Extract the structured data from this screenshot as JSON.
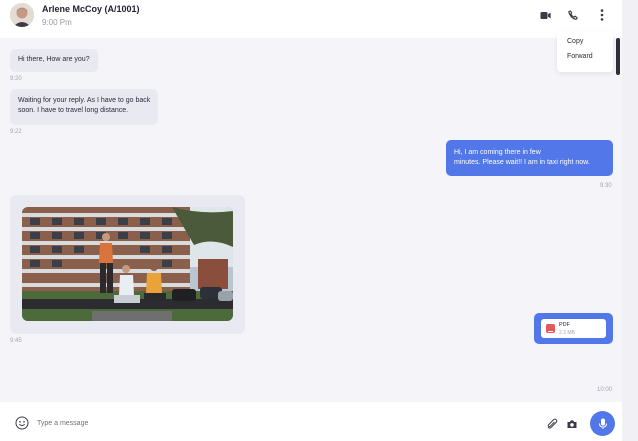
{
  "header": {
    "contact_name": "Arlene McCoy (A/1001)",
    "contact_time": "9:00 Pm",
    "icons": [
      "video-call-icon",
      "phone-call-icon",
      "more-options-icon"
    ]
  },
  "menu": {
    "items": [
      "Copy",
      "Forward"
    ]
  },
  "messages": [
    {
      "direction": "incoming",
      "text": "Hi there, How are you?",
      "time": "9:20"
    },
    {
      "direction": "incoming",
      "lines": [
        "Waiting for your reply. As I have to go back",
        "soon. I have to travel long distance."
      ],
      "time": "9:22"
    },
    {
      "direction": "outgoing",
      "lines": [
        "Hi, I am coming there in few",
        "minutes. Please wait!! I am in taxi right now."
      ],
      "time": "9:30"
    },
    {
      "direction": "incoming",
      "type": "image",
      "time": "9:45"
    },
    {
      "direction": "outgoing",
      "type": "file",
      "file_name": "PDF",
      "file_size": "2.3 MB",
      "time": "10:00"
    }
  ],
  "composer": {
    "placeholder": "Type a message",
    "icons": [
      "emoji-icon",
      "paperclip-icon",
      "camera-icon",
      "microphone-icon"
    ]
  },
  "colors": {
    "accent": "#5277e8",
    "incoming_bubble": "#e9e9f2",
    "pdf_icon": "#e8585b"
  }
}
